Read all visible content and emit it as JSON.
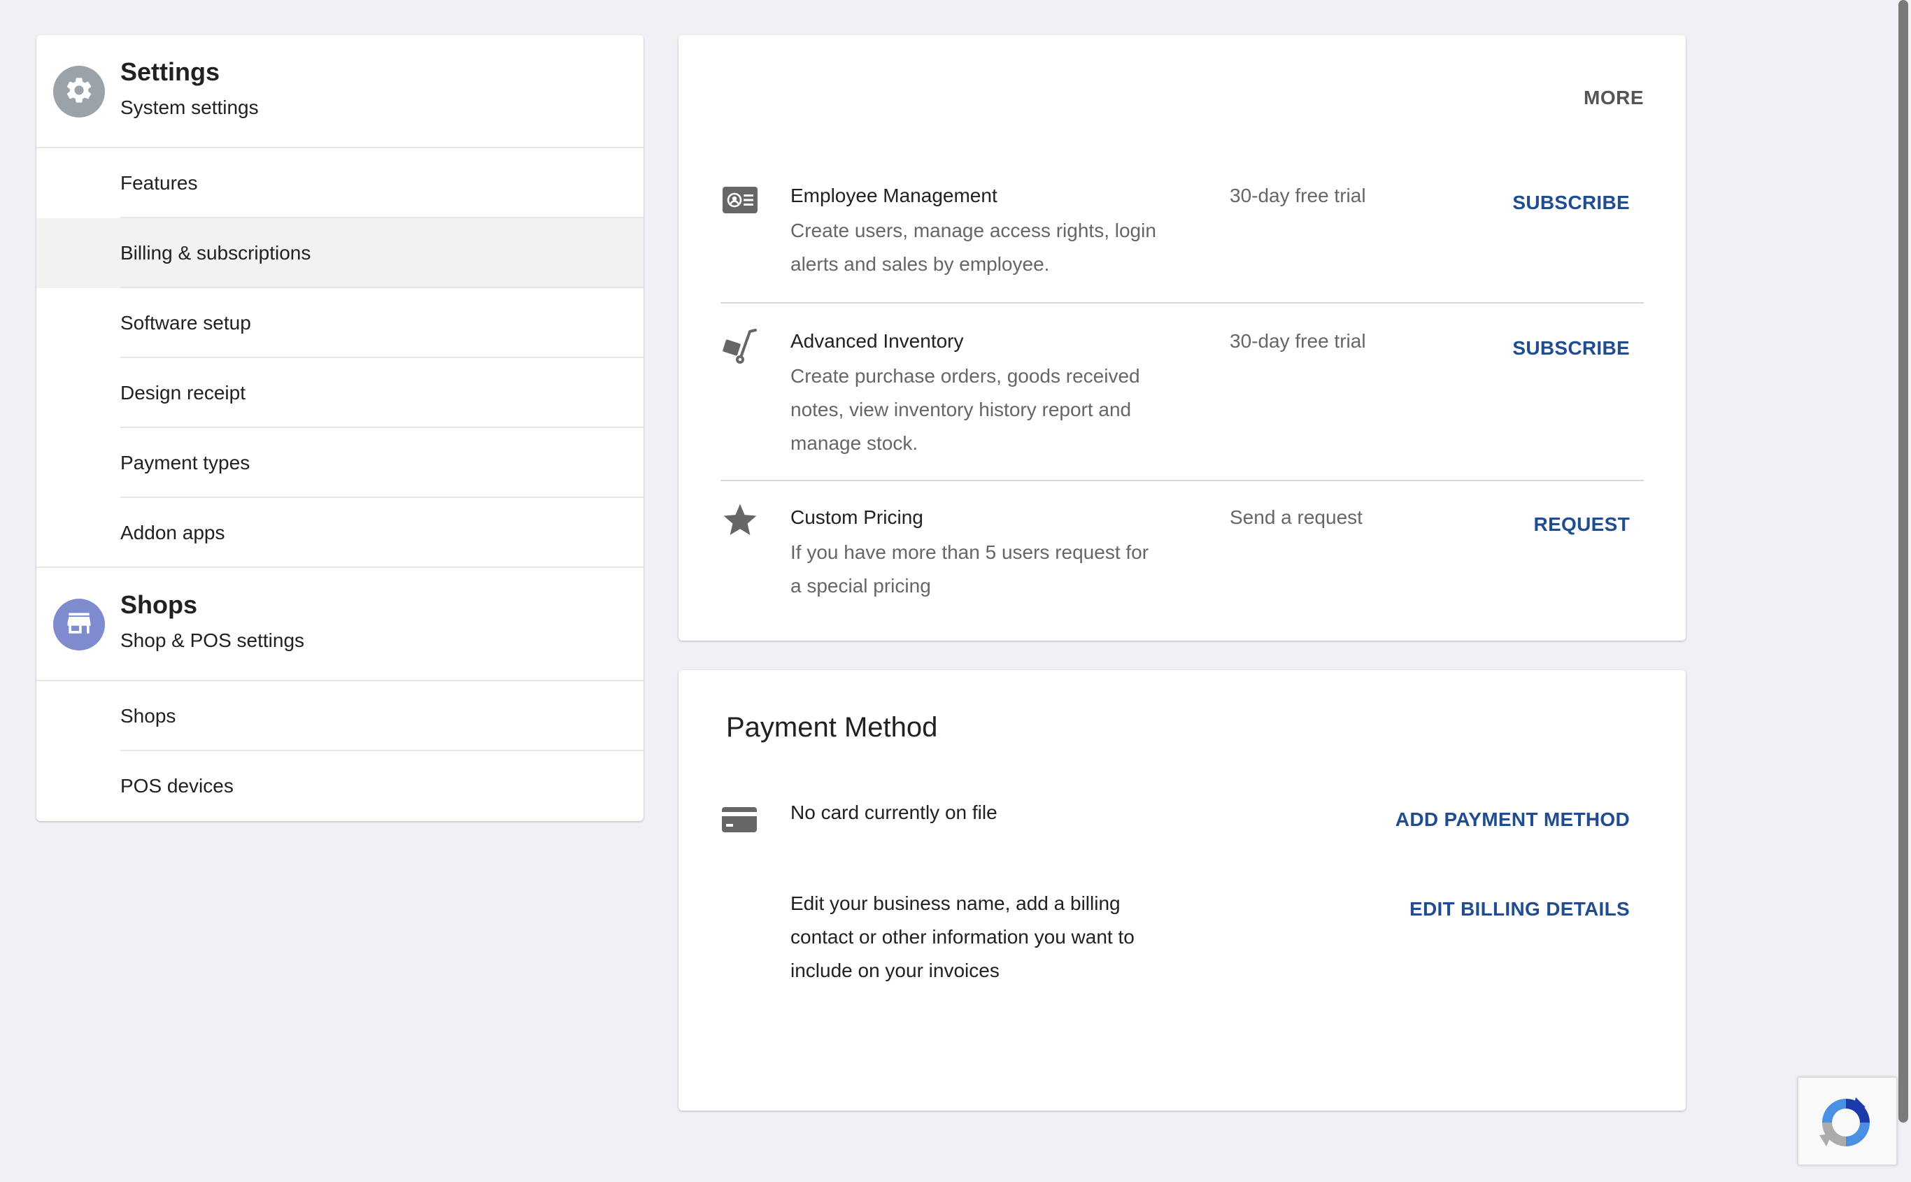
{
  "nav": {
    "settings": {
      "title": "Settings",
      "subtitle": "System settings",
      "icon": "gear-icon"
    },
    "settings_items": [
      {
        "label": "Features"
      },
      {
        "label": "Billing & subscriptions",
        "active": true
      },
      {
        "label": "Software setup"
      },
      {
        "label": "Design receipt"
      },
      {
        "label": "Payment types"
      },
      {
        "label": "Addon apps"
      }
    ],
    "shops": {
      "title": "Shops",
      "subtitle": "Shop & POS settings",
      "icon": "store-icon"
    },
    "shops_items": [
      {
        "label": "Shops"
      },
      {
        "label": "POS devices"
      }
    ]
  },
  "subscriptions": {
    "more_label": "MORE",
    "items": [
      {
        "icon": "employee-badge-icon",
        "name": "Employee Management",
        "description": "Create users, manage access rights, login alerts and sales by employee.",
        "trial": "30-day free trial",
        "action": "SUBSCRIBE"
      },
      {
        "icon": "hand-truck-icon",
        "name": "Advanced Inventory",
        "description": "Create purchase orders, goods received notes, view inventory history report and manage stock.",
        "trial": "30-day free trial",
        "action": "SUBSCRIBE"
      },
      {
        "icon": "star-icon",
        "name": "Custom Pricing",
        "description": "If you have more than 5 users request for a special pricing",
        "trial": "Send a request",
        "action": "REQUEST"
      }
    ]
  },
  "payment": {
    "title": "Payment Method",
    "card_icon": "credit-card-icon",
    "card_status": "No card currently on file",
    "add_label": "ADD PAYMENT METHOD",
    "billing_text": "Edit your business name, add a billing contact or other information you want to include on your invoices",
    "edit_label": "EDIT BILLING DETAILS"
  },
  "colors": {
    "accent_blue": "#1f4d8f",
    "settings_circle": "#9aa3aa",
    "shops_circle": "#7f8bcf",
    "page_background": "#f0f1f5"
  },
  "widgets": {
    "recaptcha_icon": "recaptcha-icon"
  }
}
